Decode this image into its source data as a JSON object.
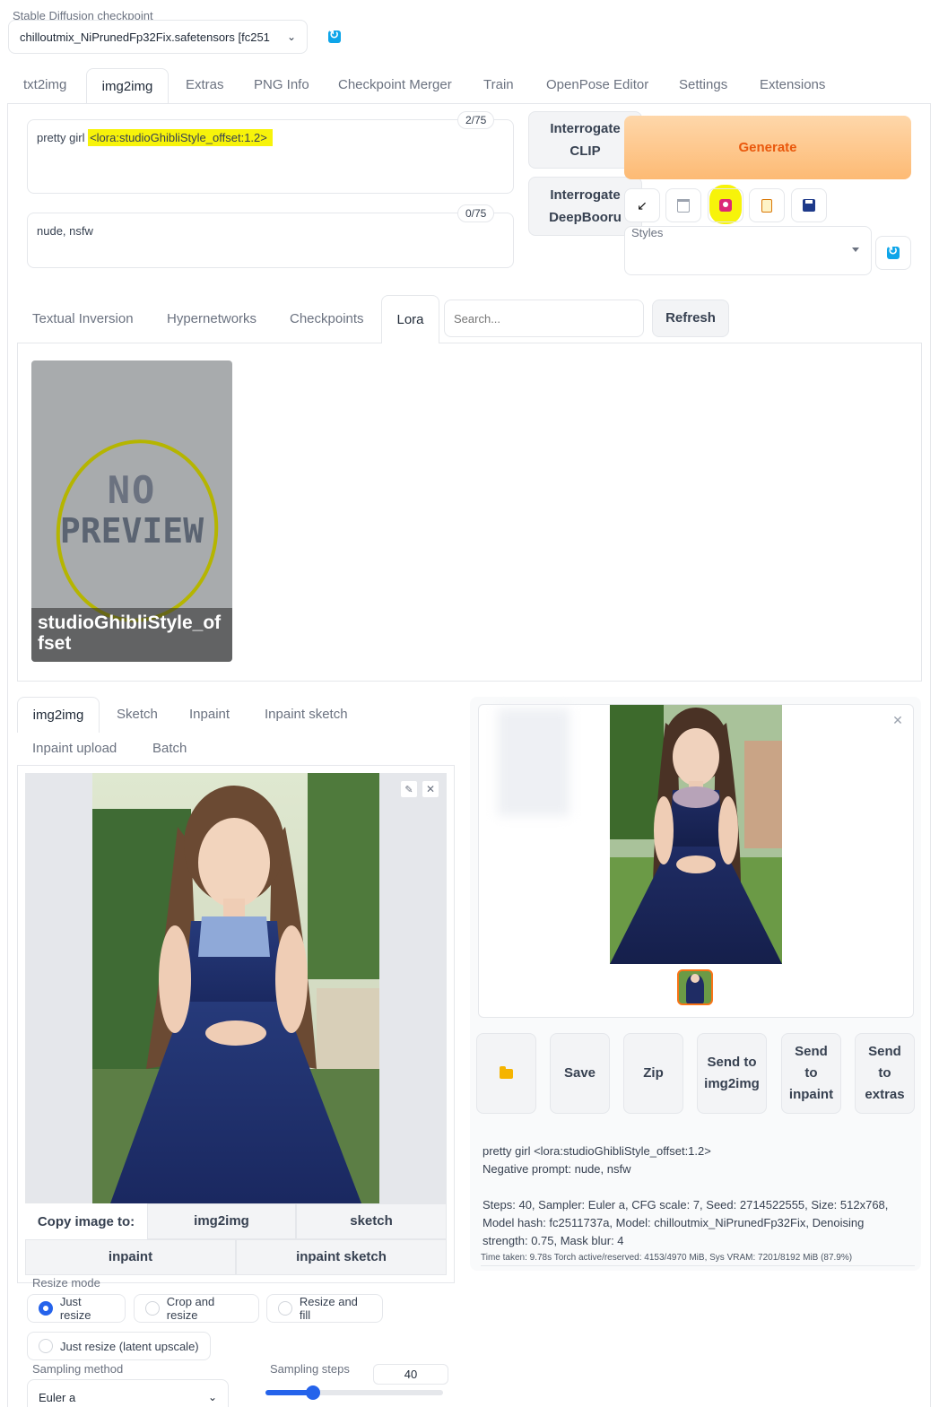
{
  "checkpoint": {
    "label": "Stable Diffusion checkpoint",
    "value": "chilloutmix_NiPrunedFp32Fix.safetensors [fc251"
  },
  "main_tabs": [
    "txt2img",
    "img2img",
    "Extras",
    "PNG Info",
    "Checkpoint Merger",
    "Train",
    "OpenPose Editor",
    "Settings",
    "Extensions"
  ],
  "prompt": {
    "text_plain": "pretty girl ",
    "text_highlight": "<lora:studioGhibliStyle_offset:1.2>",
    "counter": "2/75"
  },
  "negative_prompt": {
    "text": "nude, nsfw",
    "counter": "0/75"
  },
  "interrogate_clip": "Interrogate CLIP",
  "interrogate_deepbooru": "Interrogate DeepBooru",
  "generate_label": "Generate",
  "styles_label": "Styles",
  "network_tabs": [
    "Textual Inversion",
    "Hypernetworks",
    "Checkpoints",
    "Lora"
  ],
  "network_search_placeholder": "Search...",
  "refresh_label": "Refresh",
  "lora_card": {
    "preview_text_1": "NO",
    "preview_text_2": "PREVIEW",
    "name_line1": "studioGhibliStyle_of",
    "name_line2": "fset"
  },
  "input_tabs_row1": [
    "img2img",
    "Sketch",
    "Inpaint",
    "Inpaint sketch"
  ],
  "input_tabs_row2": [
    "Inpaint upload",
    "Batch"
  ],
  "copy_image": {
    "label": "Copy image to:",
    "targets": [
      "img2img",
      "sketch",
      "inpaint",
      "inpaint sketch"
    ]
  },
  "resize_mode": {
    "label": "Resize mode",
    "options": [
      "Just resize",
      "Crop and resize",
      "Resize and fill",
      "Just resize (latent upscale)"
    ],
    "selected": "Just resize"
  },
  "sampling_method": {
    "label": "Sampling method",
    "value": "Euler a"
  },
  "sampling_steps": {
    "label": "Sampling steps",
    "value": "40",
    "fraction": 0.27
  },
  "output_buttons": {
    "save": "Save",
    "zip": "Zip",
    "send_img2img_1": "Send to",
    "send_img2img_2": "img2img",
    "send_inpaint_1": "Send",
    "send_inpaint_2": "to",
    "send_inpaint_3": "inpaint",
    "send_extras_1": "Send",
    "send_extras_2": "to",
    "send_extras_3": "extras"
  },
  "generation_info": {
    "line1": "pretty girl <lora:studioGhibliStyle_offset:1.2>",
    "line2": "Negative prompt: nude, nsfw",
    "params": "Steps: 40, Sampler: Euler a, CFG scale: 7, Seed: 2714522555, Size: 512x768, Model hash: fc2511737a, Model: chilloutmix_NiPrunedFp32Fix, Denoising strength: 0.75, Mask blur: 4",
    "timing": "Time taken: 9.78s  Torch active/reserved: 4153/4970 MiB, Sys VRAM: 7201/8192 MiB (87.9%)"
  },
  "colors": {
    "generate_bg": "#fdba74",
    "generate_text": "#ea580c",
    "highlight": "#f7f30a",
    "accent_blue": "#2563eb",
    "refresh_blue": "#0ea5e9"
  },
  "icons": [
    "refresh-icon",
    "arrow-diagonal-icon",
    "trash-icon",
    "extra-networks-icon",
    "clipboard-icon",
    "save-style-icon",
    "folder-icon",
    "edit-icon",
    "close-icon",
    "chevron-down-icon"
  ]
}
